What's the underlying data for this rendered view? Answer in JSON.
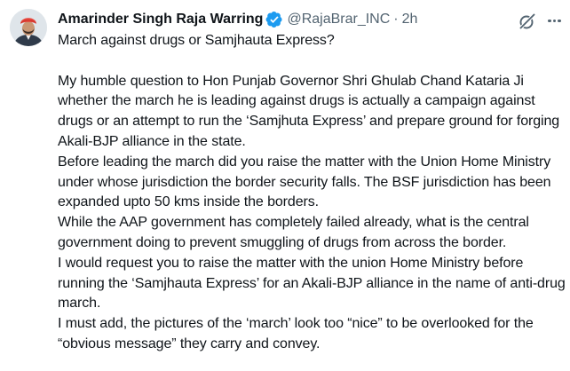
{
  "tweet": {
    "author_name": "Amarinder Singh Raja Warring",
    "handle": "@RajaBrar_INC",
    "separator": "·",
    "time": "2h",
    "paragraphs": [
      "March against drugs or Samjhauta Express?",
      "",
      "My humble question to Hon Punjab Governor Shri Ghulab Chand Kataria Ji whether the march he is leading against drugs is actually a campaign against drugs or an attempt to run the ‘Samjhuta Express’ and prepare ground for forging Akali-BJP alliance in the state.",
      "Before leading the march did you raise the matter with the Union Home Ministry under whose jurisdiction the border security falls. The BSF jurisdiction has been expanded upto 50 kms inside the borders.",
      "While the AAP government has completely failed already, what is the central government doing to prevent smuggling of drugs from across the border.",
      "I would request you to raise the matter with the union Home Ministry before running the ‘Samjhauta Express’ for an Akali-BJP alliance in the name of anti-drug march.",
      "I must add, the pictures of the ‘march’ look too “nice” to be overlooked for the “obvious message” they carry and convey."
    ],
    "icons": {
      "verified": "verified-badge-icon",
      "grok": "grok-icon",
      "more": "more-options-icon"
    },
    "colors": {
      "text": "#0f1419",
      "secondary": "#536471",
      "verified": "#1d9bf0"
    }
  }
}
